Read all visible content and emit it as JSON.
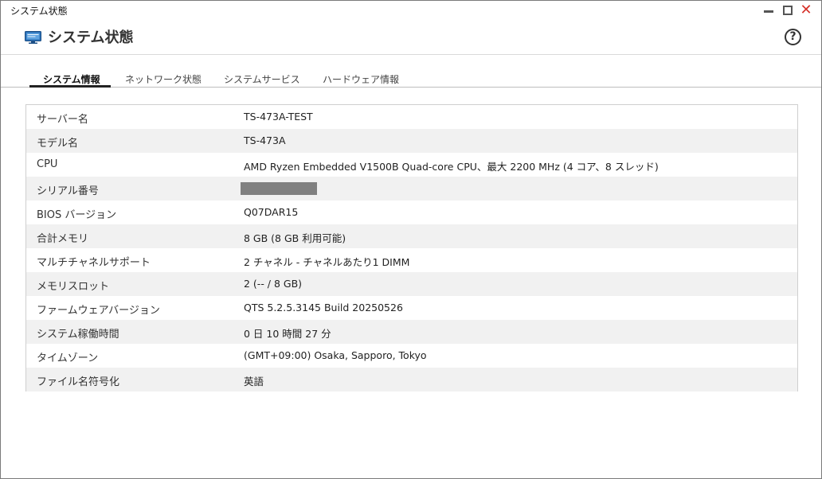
{
  "window": {
    "title": "システム状態"
  },
  "header": {
    "title": "システム状態",
    "icon": "monitor-icon",
    "help_label": "?"
  },
  "tabs": [
    {
      "label": "システム情報",
      "active": true
    },
    {
      "label": "ネットワーク状態",
      "active": false
    },
    {
      "label": "システムサービス",
      "active": false
    },
    {
      "label": "ハードウェア情報",
      "active": false
    }
  ],
  "system_info": {
    "rows": [
      {
        "label": "サーバー名",
        "value": "TS-473A-TEST"
      },
      {
        "label": "モデル名",
        "value": "TS-473A"
      },
      {
        "label": "CPU",
        "value": "AMD Ryzen Embedded V1500B Quad-core CPU、最大 2200 MHz (4 コア、8 スレッド)"
      },
      {
        "label": "シリアル番号",
        "value": ""
      },
      {
        "label": "BIOS バージョン",
        "value": "Q07DAR15"
      },
      {
        "label": "合計メモリ",
        "value": "8 GB (8 GB 利用可能)"
      },
      {
        "label": "マルチチャネルサポート",
        "value": "2 チャネル - チャネルあたり1 DIMM"
      },
      {
        "label": "メモリスロット",
        "value": "2 (-- / 8 GB)"
      },
      {
        "label": "ファームウェアバージョン",
        "value": "QTS 5.2.5.3145 Build 20250526"
      },
      {
        "label": "システム稼働時間",
        "value": "0 日 10 時間 27 分"
      },
      {
        "label": "タイムゾーン",
        "value": "(GMT+09:00) Osaka, Sapporo, Tokyo"
      },
      {
        "label": "ファイル名符号化",
        "value": "英語"
      }
    ]
  },
  "colors": {
    "close": "#d6322a",
    "row_alt": "#f1f1f1",
    "redacted": "#808080"
  }
}
